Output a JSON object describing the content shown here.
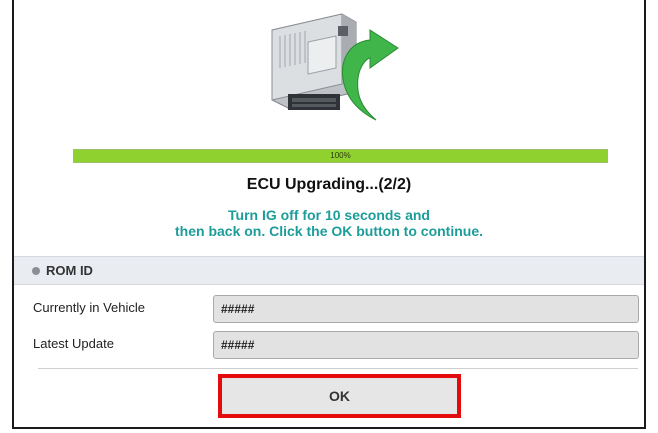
{
  "progress": {
    "percent": 100,
    "label": "100%",
    "fill_color": "#8fd12f"
  },
  "status": {
    "title": "ECU Upgrading...(2/2)"
  },
  "instruction": {
    "line1": "Turn IG off for 10 seconds and",
    "line2": "then back on. Click the OK button to continue.",
    "color": "#1d9d9a"
  },
  "rom_id": {
    "section_label": "ROM ID",
    "rows": [
      {
        "label": "Currently in Vehicle",
        "value": "#####"
      },
      {
        "label": "Latest Update",
        "value": "#####"
      }
    ]
  },
  "actions": {
    "ok_label": "OK",
    "highlight_color": "#e30b0b"
  },
  "icons": {
    "illustration": "ecu-upgrade-icon"
  }
}
